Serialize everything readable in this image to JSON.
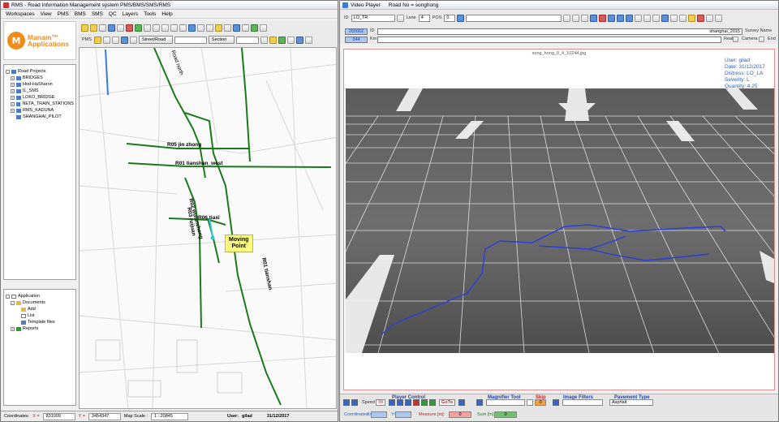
{
  "left_window": {
    "title": "RMS - Road Information Management system PMS/BMS/SMS/RMS",
    "menu": [
      "Workspaces",
      "View",
      "PMS",
      "BMS",
      "SMS",
      "QC",
      "Layers",
      "Tools",
      "Help"
    ],
    "logo_line1": "Manam™",
    "logo_line2": "Applications",
    "logo_mark": "M",
    "toolbar": {
      "street_road": "Street/Road",
      "section": "Section",
      "label_pms": "PMS",
      "label_bms": "BMS",
      "label_sms": "SMS"
    },
    "road_tree": {
      "root": "Road Projects",
      "items": [
        "BRIDGES",
        "Hod-HaSharon",
        "IL_SMS",
        "LOKO_BRIDGE",
        "NETA_TRAIN_STATIONS",
        "RMS_KADUNA",
        "SHANGHAI_PILOT"
      ]
    },
    "app_tree": {
      "root": "Application",
      "documents": "Documents",
      "doc_items": [
        "Add",
        "List",
        "Template files"
      ],
      "reports": "Reports"
    },
    "map": {
      "road_labels": [
        "R05 jin zhong",
        "R01 tianshan_west",
        "R02 wulanzhong",
        "R06 tiaxi",
        "R03 ruijuan",
        "R01 tianshan",
        "Road north"
      ],
      "moving_point_line1": "Moving",
      "moving_point_line2": "Point"
    },
    "status": {
      "coordinates_label": "Coordinates:",
      "x_label": "X =",
      "x_value": "831009",
      "y_label": "Y =",
      "y_value": "3454347",
      "map_scale_label": "Map Scale :",
      "map_scale_value": "1 : 20845",
      "user_label": "User:",
      "user_value": "gilad",
      "date": "31/12/2017"
    }
  },
  "right_window": {
    "title": "Video Player",
    "road_no": "Road No = songhong",
    "toolbar": {
      "id_label": "ID",
      "distress": "LO_TR",
      "lane_label": "Lane",
      "lane_value": "4",
      "pos_label": "POS",
      "pos_value": "0"
    },
    "row2": {
      "id_value": "200002",
      "id_label": "ID",
      "km_value": "344",
      "km_label": "Km",
      "survey_value": "shanghai_2015",
      "survey_label": "Survey Name",
      "real_label": "Real",
      "camera_label": "Camera",
      "end_label": "End"
    },
    "video": {
      "filename": "song_hong_0_4_10244.jpg",
      "info": [
        "User: gilad",
        "Date: 31/12/2017",
        "Distress: LO_LA",
        "Severity: L",
        "Quantity: 4.25"
      ]
    },
    "bottom": {
      "player_control": "Player Control",
      "speed_label": "Speed",
      "speed_value": "99",
      "goto_label": "GoTo",
      "magnifier_tool": "Magnifier Tool",
      "skip_label": "Skip",
      "skip_value": "0",
      "image_filters": "Image Filters",
      "pavement_type": "Pavement Type",
      "pavement_value": "Asphalt",
      "coordinates_label": "Coordinates:",
      "x_label": "X=",
      "y_label": "Y=",
      "measure_label": "Measure [m]:",
      "measure_value": "0",
      "sum_label": "Sum [m]:",
      "sum_value": "0"
    }
  },
  "colors": {
    "road_line": "#1a7a1a",
    "crack_line": "#2b3fd6",
    "info_text": "#1f5fbf",
    "moving_point": "#fdfd80"
  }
}
